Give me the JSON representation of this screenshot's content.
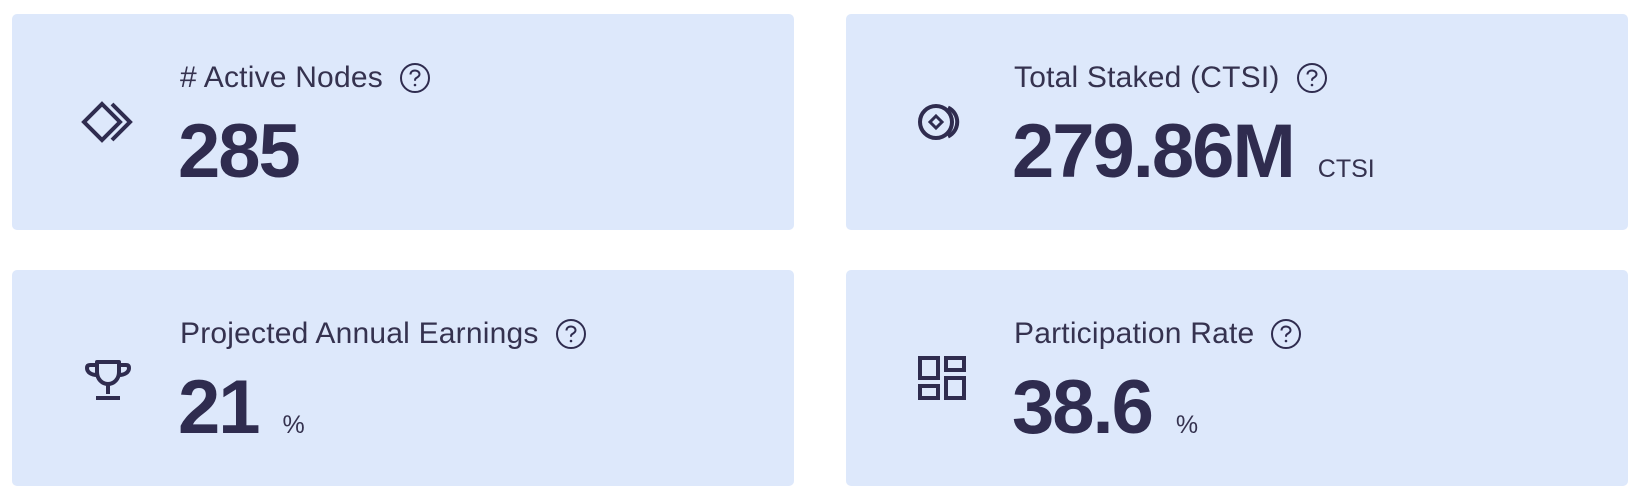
{
  "cards": [
    {
      "icon": "diamond-chevron-icon",
      "label": "# Active Nodes",
      "value": "285",
      "unit": ""
    },
    {
      "icon": "coin-stack-icon",
      "label": "Total Staked (CTSI)",
      "value": "279.86M",
      "unit": "CTSI"
    },
    {
      "icon": "trophy-icon",
      "label": "Projected Annual Earnings",
      "value": "21",
      "unit": "%"
    },
    {
      "icon": "dashboard-grid-icon",
      "label": "Participation Rate",
      "value": "38.6",
      "unit": "%"
    }
  ],
  "colors": {
    "card_background": "#dde8fb",
    "text": "#2f2c4f"
  }
}
